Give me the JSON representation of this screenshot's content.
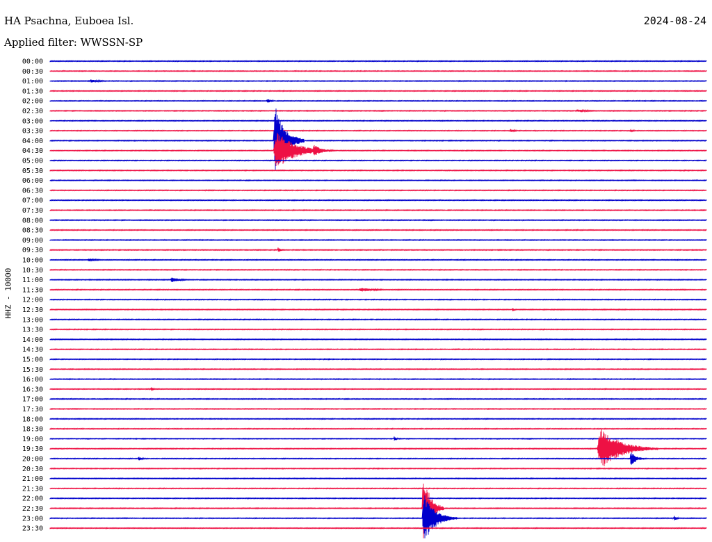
{
  "station_title": "HA Psachna, Euboea Isl.",
  "date": "2024-08-24",
  "filter_label": "Applied filter: WWSSN-SP",
  "channel_label": "HHZ - 10000",
  "colors": {
    "even_trace": "#0000cc",
    "odd_trace": "#ee1144",
    "background": "#ffffff",
    "text": "#000000"
  },
  "chart_data": {
    "type": "line",
    "plot_kind": "helicorder",
    "title": "HA Psachna, Euboea Isl.",
    "ylabel": "HHZ - 10000",
    "row_labels": [
      "00:00",
      "00:30",
      "01:00",
      "01:30",
      "02:00",
      "02:30",
      "03:00",
      "03:30",
      "04:00",
      "04:30",
      "05:00",
      "05:30",
      "06:00",
      "06:30",
      "07:00",
      "07:30",
      "08:00",
      "08:30",
      "09:00",
      "09:30",
      "10:00",
      "10:30",
      "11:00",
      "11:30",
      "12:00",
      "12:30",
      "13:00",
      "13:30",
      "14:00",
      "14:30",
      "15:00",
      "15:30",
      "16:00",
      "16:30",
      "17:00",
      "17:30",
      "18:00",
      "18:30",
      "19:00",
      "19:30",
      "20:00",
      "20:30",
      "21:00",
      "21:30",
      "22:00",
      "22:30",
      "23:00",
      "23:30"
    ],
    "row_duration_min": 30,
    "events": [
      {
        "row": "04:00",
        "start_min": 10.2,
        "duration_min": 1.4,
        "amplitude": 4.5
      },
      {
        "row": "04:30",
        "start_min": 10.2,
        "duration_min": 2.6,
        "amplitude": 2.4
      },
      {
        "row": "04:30",
        "start_min": 12.0,
        "duration_min": 1.1,
        "amplitude": 0.8
      },
      {
        "row": "19:30",
        "start_min": 25.0,
        "duration_min": 2.8,
        "amplitude": 2.6
      },
      {
        "row": "20:00",
        "start_min": 26.5,
        "duration_min": 0.8,
        "amplitude": 0.9
      },
      {
        "row": "22:30",
        "start_min": 17.0,
        "duration_min": 1.0,
        "amplitude": 4.4
      },
      {
        "row": "23:00",
        "start_min": 17.0,
        "duration_min": 1.6,
        "amplitude": 3.0
      },
      {
        "row": "11:00",
        "start_min": 5.5,
        "duration_min": 1.1,
        "amplitude": 0.35
      },
      {
        "row": "02:00",
        "start_min": 9.9,
        "duration_min": 0.5,
        "amplitude": 0.3
      },
      {
        "row": "09:30",
        "start_min": 10.4,
        "duration_min": 0.4,
        "amplitude": 0.3
      },
      {
        "row": "11:30",
        "start_min": 14.1,
        "duration_min": 2.1,
        "amplitude": 0.25
      },
      {
        "row": "12:30",
        "start_min": 21.1,
        "duration_min": 0.3,
        "amplitude": 0.3
      },
      {
        "row": "16:30",
        "start_min": 4.6,
        "duration_min": 0.3,
        "amplitude": 0.3
      },
      {
        "row": "19:00",
        "start_min": 15.7,
        "duration_min": 0.3,
        "amplitude": 0.35
      },
      {
        "row": "20:00",
        "start_min": 4.0,
        "duration_min": 0.5,
        "amplitude": 0.3
      },
      {
        "row": "23:00",
        "start_min": 28.5,
        "duration_min": 0.4,
        "amplitude": 0.35
      },
      {
        "row": "01:00",
        "start_min": 1.8,
        "duration_min": 1.3,
        "amplitude": 0.2
      },
      {
        "row": "03:30",
        "start_min": 21.0,
        "duration_min": 0.7,
        "amplitude": 0.2
      },
      {
        "row": "03:30",
        "start_min": 26.5,
        "duration_min": 0.5,
        "amplitude": 0.2
      },
      {
        "row": "02:30",
        "start_min": 24.0,
        "duration_min": 2.0,
        "amplitude": 0.15
      },
      {
        "row": "10:00",
        "start_min": 1.7,
        "duration_min": 1.2,
        "amplitude": 0.18
      }
    ]
  }
}
